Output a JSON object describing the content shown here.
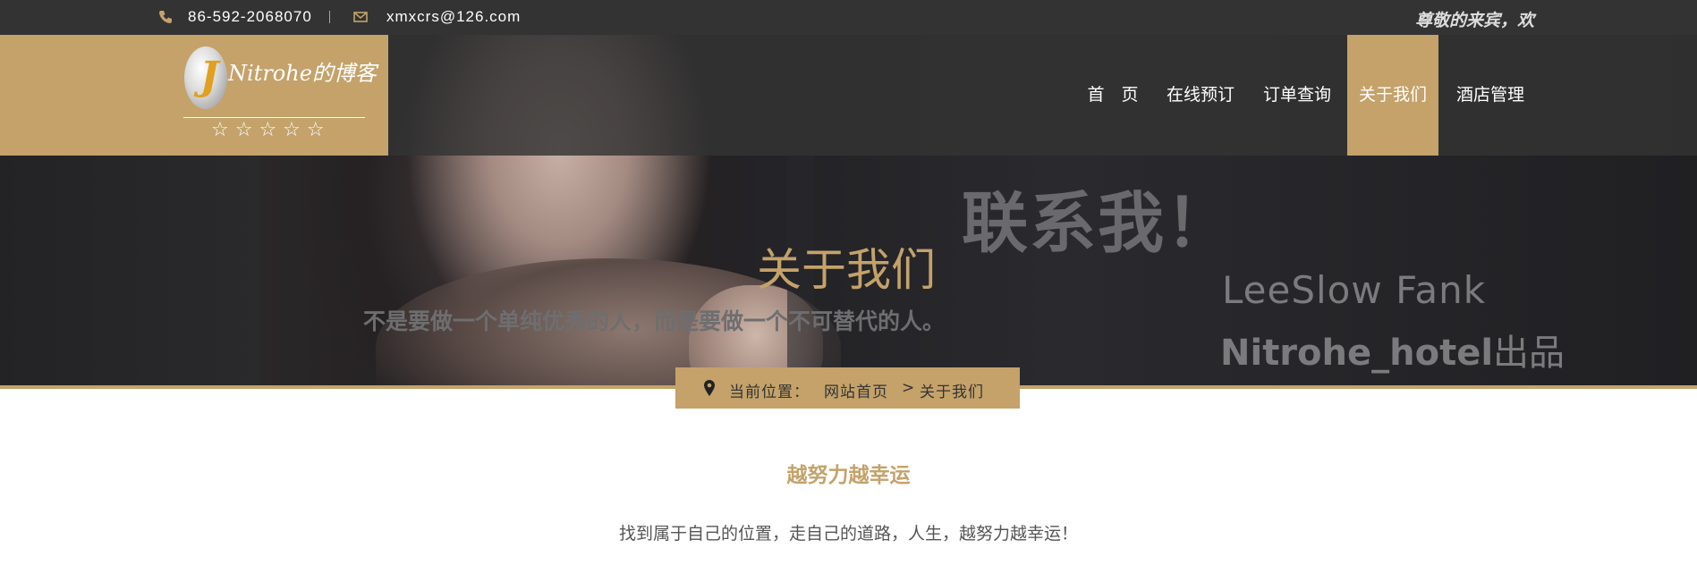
{
  "topbar": {
    "phone": "86-592-2068070",
    "email": "xmxcrs@126.com",
    "marquee": "尊敬的来宾，欢"
  },
  "logo": {
    "brand_text": "Nitrohe的博客",
    "stars": "☆☆☆☆☆"
  },
  "nav": {
    "items": [
      {
        "label": "首　页"
      },
      {
        "label": "在线预订"
      },
      {
        "label": "订单查询"
      },
      {
        "label": "关于我们",
        "active": true
      },
      {
        "label": "酒店管理"
      }
    ]
  },
  "hero": {
    "contact_text": "联系我！",
    "signature_line1": "LeeSlow Fank",
    "signature_line2_bold": "Nitrohe_hotel",
    "signature_line2_plain": "出品",
    "page_title": "关于我们",
    "motto": "不是要做一个单纯优秀的人，而是要做一个不可替代的人。"
  },
  "breadcrumb": {
    "prefix": "当前位置：",
    "home": "网站首页",
    "separator": ">",
    "current": "关于我们"
  },
  "content": {
    "title": "越努力越幸运",
    "description": "找到属于自己的位置，走自己的道路，人生，越努力越幸运！"
  },
  "colors": {
    "accent_gold": "#c4a26a",
    "topbar_bg": "#333333",
    "text_dark": "#555555"
  },
  "icons": [
    "phone-icon",
    "envelope-icon",
    "map-pin-icon",
    "star-icon"
  ]
}
